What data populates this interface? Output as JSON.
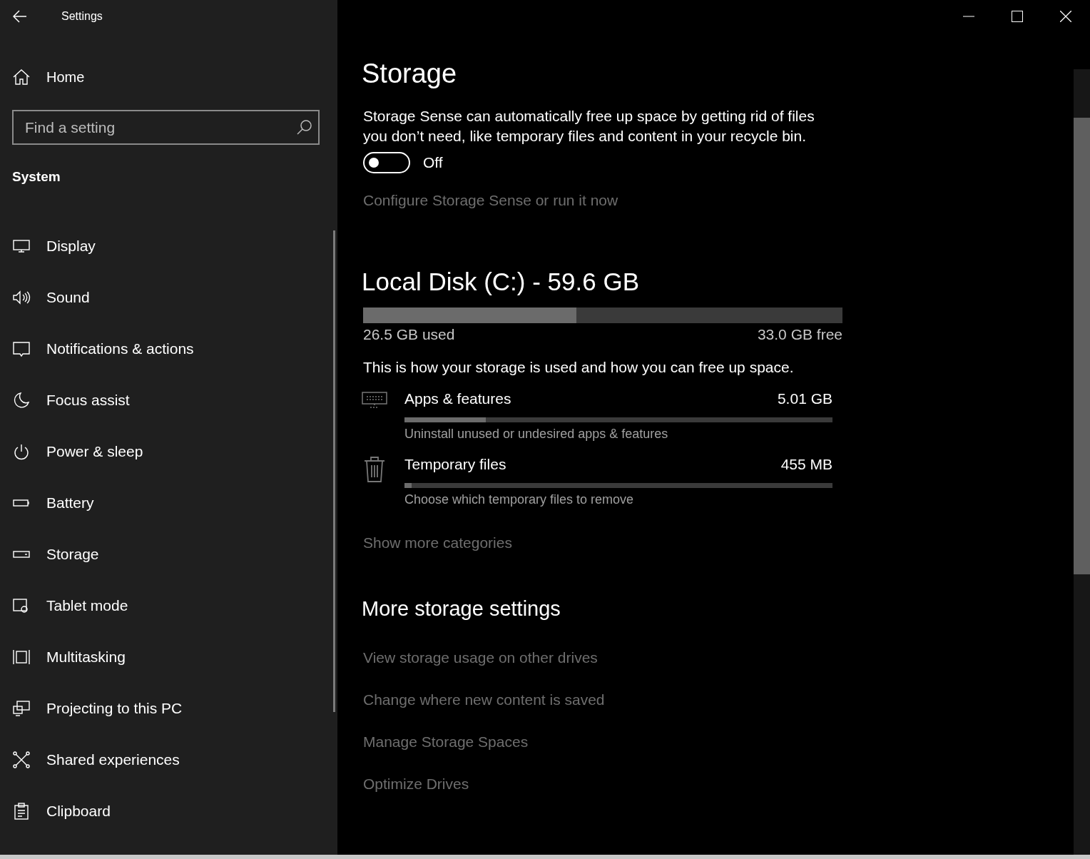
{
  "window": {
    "title": "Settings"
  },
  "sidebar": {
    "home": "Home",
    "search": {
      "placeholder": "Find a setting"
    },
    "section": "System",
    "items": [
      {
        "label": "Display"
      },
      {
        "label": "Sound"
      },
      {
        "label": "Notifications & actions"
      },
      {
        "label": "Focus assist"
      },
      {
        "label": "Power & sleep"
      },
      {
        "label": "Battery"
      },
      {
        "label": "Storage"
      },
      {
        "label": "Tablet mode"
      },
      {
        "label": "Multitasking"
      },
      {
        "label": "Projecting to this PC"
      },
      {
        "label": "Shared experiences"
      },
      {
        "label": "Clipboard"
      }
    ]
  },
  "page": {
    "title": "Storage",
    "description": "Storage Sense can automatically free up space by getting rid of files you don’t need, like temporary files and content in your recycle bin.",
    "storage_sense": {
      "on": false,
      "label": "Off"
    },
    "configure_link": "Configure Storage Sense or run it now",
    "disk": {
      "title": "Local Disk (C:) - 59.6 GB",
      "level": 0.445,
      "used": "26.5 GB used",
      "free": "33.0 GB free"
    },
    "usage_intro": "This is how your storage is used and how you can free up space.",
    "categories": [
      {
        "name": "Apps & features",
        "size": "5.01 GB",
        "level": 0.19,
        "hint": "Uninstall unused or undesired apps & features"
      },
      {
        "name": "Temporary files",
        "size": "455 MB",
        "level": 0.017,
        "hint": "Choose which temporary files to remove"
      }
    ],
    "show_more": "Show more categories",
    "more_title": "More storage settings",
    "more_links": [
      "View storage usage on other drives",
      "Change where new content is saved",
      "Manage Storage Spaces",
      "Optimize Drives"
    ]
  }
}
